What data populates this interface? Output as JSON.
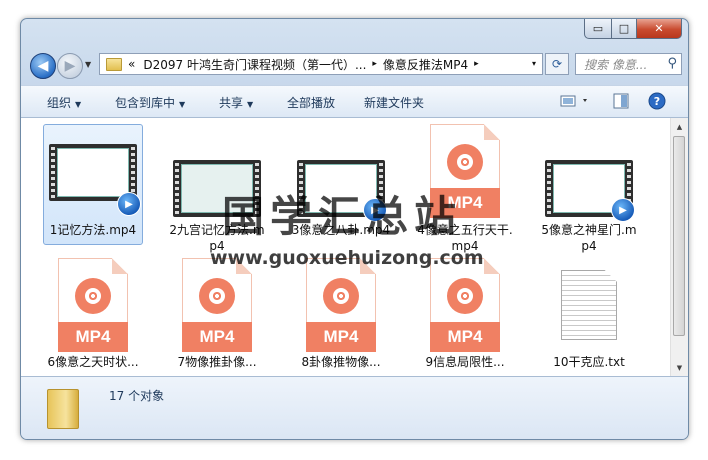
{
  "window": {
    "title_buttons": {
      "minimize": "▭",
      "maximize": "□",
      "close": "✕"
    }
  },
  "address": {
    "overflow": "«",
    "crumbs": [
      "D2097 叶鸿生奇门课程视频（第一代）...",
      "像意反推法MP4"
    ],
    "separator": "▸",
    "dropdown": "▾"
  },
  "search": {
    "placeholder": "搜索 像意..."
  },
  "toolbar": {
    "organize": "组织",
    "include_in_library": "包含到库中",
    "share": "共享",
    "play_all": "全部播放",
    "new_folder": "新建文件夹"
  },
  "files": [
    {
      "name": "1记忆方法.mp4",
      "type": "video",
      "selected": true
    },
    {
      "name": "2九宫记忆方法.mp4",
      "type": "video",
      "selected": false
    },
    {
      "name": "3像意之八卦.mp4",
      "type": "video",
      "selected": false
    },
    {
      "name": "4像意之五行天干.mp4",
      "type": "mp4",
      "selected": false
    },
    {
      "name": "5像意之神星门.mp4",
      "type": "video",
      "selected": false
    },
    {
      "name": "6像意之天时状...",
      "type": "mp4",
      "selected": false
    },
    {
      "name": "7物像推卦像...",
      "type": "mp4",
      "selected": false
    },
    {
      "name": "8卦像推物像...",
      "type": "mp4",
      "selected": false
    },
    {
      "name": "9信息局限性...",
      "type": "mp4",
      "selected": false
    },
    {
      "name": "10干克应.txt",
      "type": "txt",
      "selected": false
    }
  ],
  "mp4_label": "MP4",
  "status": {
    "count": "17 个对象"
  },
  "watermark": {
    "title": "国学汇总站",
    "url": "www.guoxuehuizong.com"
  },
  "colors": {
    "mp4_orange": "#f08063",
    "accent": "#2a6fc6",
    "watermark": "#000000"
  }
}
